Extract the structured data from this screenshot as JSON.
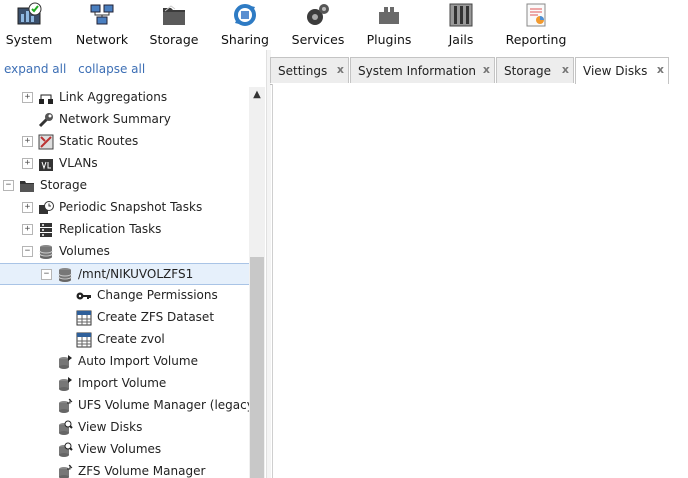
{
  "toolbar": {
    "items": [
      {
        "label": "System",
        "icon": "system-icon"
      },
      {
        "label": "Network",
        "icon": "network-icon"
      },
      {
        "label": "Storage",
        "icon": "storage-icon"
      },
      {
        "label": "Sharing",
        "icon": "sharing-icon"
      },
      {
        "label": "Services",
        "icon": "services-icon"
      },
      {
        "label": "Plugins",
        "icon": "plugins-icon"
      },
      {
        "label": "Jails",
        "icon": "jails-icon"
      },
      {
        "label": "Reporting",
        "icon": "reporting-icon"
      }
    ]
  },
  "tree_controls": {
    "expand_all": "expand all",
    "collapse_all": "collapse all"
  },
  "tree": {
    "items": [
      {
        "label": "Link Aggregations",
        "icon": "link-aggregation-icon",
        "expander": "+"
      },
      {
        "label": "Network Summary",
        "icon": "wrench-icon"
      },
      {
        "label": "Static Routes",
        "icon": "routes-icon",
        "expander": "+"
      },
      {
        "label": "VLANs",
        "icon": "vlan-icon",
        "expander": "+"
      },
      {
        "label": "Storage",
        "icon": "folder-icon",
        "expander": "−"
      },
      {
        "label": "Periodic Snapshot Tasks",
        "icon": "snapshot-icon",
        "expander": "+"
      },
      {
        "label": "Replication Tasks",
        "icon": "replication-icon",
        "expander": "+"
      },
      {
        "label": "Volumes",
        "icon": "volume-icon",
        "expander": "−"
      },
      {
        "label": "/mnt/NIKUVOLZFS1",
        "icon": "volume-icon",
        "expander": "−"
      },
      {
        "label": "Change Permissions",
        "icon": "key-icon"
      },
      {
        "label": "Create ZFS Dataset",
        "icon": "dataset-icon"
      },
      {
        "label": "Create zvol",
        "icon": "zvol-icon"
      },
      {
        "label": "Auto Import Volume",
        "icon": "auto-import-icon"
      },
      {
        "label": "Import Volume",
        "icon": "import-icon"
      },
      {
        "label": "UFS Volume Manager (legacy)",
        "icon": "ufs-manager-icon"
      },
      {
        "label": "View Disks",
        "icon": "view-disks-icon"
      },
      {
        "label": "View Volumes",
        "icon": "view-volumes-icon"
      },
      {
        "label": "ZFS Volume Manager",
        "icon": "zfs-manager-icon"
      }
    ]
  },
  "tabs": [
    {
      "label": "Settings",
      "close": "x"
    },
    {
      "label": "System Information",
      "close": "x"
    },
    {
      "label": "Storage",
      "close": "x"
    },
    {
      "label": "View Disks",
      "close": "x",
      "active": true
    }
  ],
  "colors": {
    "link": "#3d6fb5",
    "selected_row": "#e6f0fb",
    "tab_bg": "#ededed"
  }
}
